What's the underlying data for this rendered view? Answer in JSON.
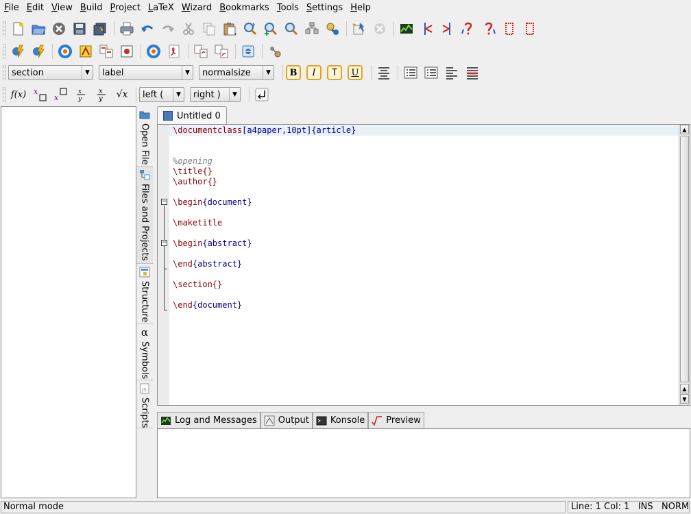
{
  "menu": [
    "File",
    "Edit",
    "View",
    "Build",
    "Project",
    "LaTeX",
    "Wizard",
    "Bookmarks",
    "Tools",
    "Settings",
    "Help"
  ],
  "toolbar": {
    "section_combo": "section",
    "label_combo": "label",
    "size_combo": "normalsize",
    "bold_label": "B",
    "italic_label": "I",
    "typewriter_label": "T",
    "underline_label": "U",
    "left_delim_combo": "left (",
    "right_delim_combo": "right )"
  },
  "math": {
    "function": "f(x)",
    "sqrt": "√x"
  },
  "side_tabs": {
    "open_file": "Open File",
    "files_projects": "Files and Projects",
    "structure": "Structure",
    "symbols": "Symbols",
    "scripts": "Scripts"
  },
  "editor": {
    "tab_label": "Untitled 0",
    "lines": {
      "l1_cmd": "\\documentclass",
      "l1_opt": "[a4paper,10pt]",
      "l1_arg": "{article}",
      "l4": "%opening",
      "l5": "\\title{}",
      "l6": "\\author{}",
      "l8_cmd": "\\begin",
      "l8_arg": "{document}",
      "l10": "\\maketitle",
      "l12_cmd": "\\begin",
      "l12_arg": "{abstract}",
      "l14_cmd": "\\end",
      "l14_arg": "{abstract}",
      "l16": "\\section{}",
      "l18_cmd": "\\end",
      "l18_arg": "{document}"
    }
  },
  "bottom_tabs": {
    "log": "Log and Messages",
    "output": "Output",
    "konsole": "Konsole",
    "preview": "Preview"
  },
  "status": {
    "mode": "Normal mode",
    "position": "Line: 1 Col: 1   INS   NORM  *"
  },
  "colors": {
    "keyword": "#8b0000",
    "argument": "#00008b",
    "comment": "#808080",
    "current_line": "#e9f0f8"
  }
}
